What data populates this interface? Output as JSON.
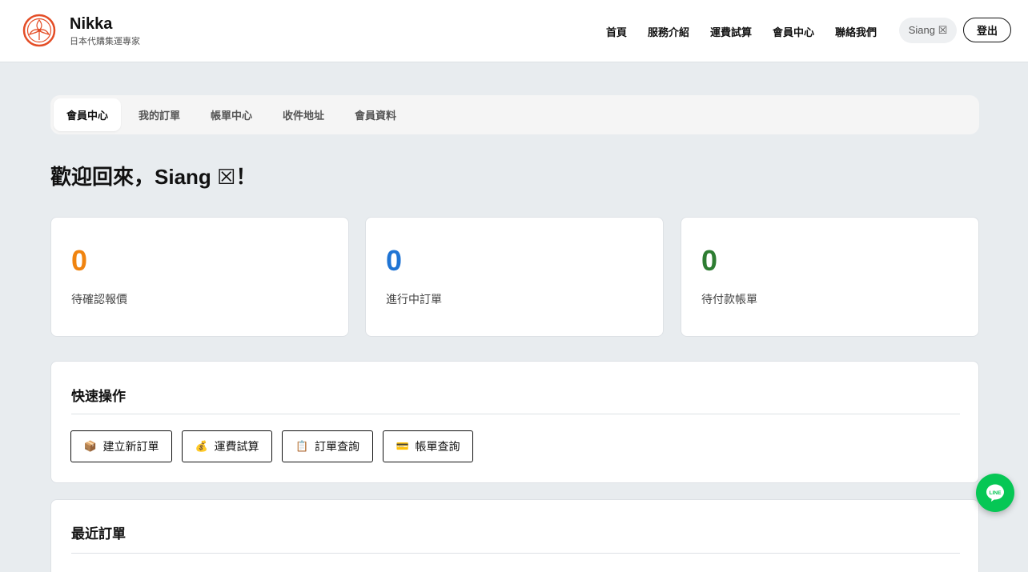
{
  "brand": {
    "name": "Nikka",
    "tagline": "日本代購集運專家"
  },
  "nav": {
    "items": [
      "首頁",
      "服務介紹",
      "運費試算",
      "會員中心",
      "聯絡我們"
    ],
    "user_label": "Siang ☒",
    "logout_label": "登出"
  },
  "tabs": [
    "會員中心",
    "我的訂單",
    "帳單中心",
    "收件地址",
    "會員資料"
  ],
  "active_tab": "會員中心",
  "welcome": "歡迎回來，Siang ☒！",
  "stats": [
    {
      "value": "0",
      "label": "待確認報價",
      "color": "#f08410"
    },
    {
      "value": "0",
      "label": "進行中訂單",
      "color": "#1f74d4"
    },
    {
      "value": "0",
      "label": "待付款帳單",
      "color": "#2e7d32"
    }
  ],
  "quick_actions": {
    "title": "快速操作",
    "buttons": [
      {
        "icon": "package-icon",
        "glyph": "📦",
        "label": "建立新訂單"
      },
      {
        "icon": "money-bag-icon",
        "glyph": "💰",
        "label": "運費試算"
      },
      {
        "icon": "clipboard-icon",
        "glyph": "📋",
        "label": "訂單查詢"
      },
      {
        "icon": "credit-card-icon",
        "glyph": "💳",
        "label": "帳單查詢"
      }
    ]
  },
  "recent_orders": {
    "title": "最近訂單"
  },
  "colors": {
    "accent_orange": "#f08410",
    "accent_blue": "#1f74d4",
    "accent_green": "#2e7d32",
    "logo_red": "#e44d26",
    "line_green": "#06c755"
  }
}
